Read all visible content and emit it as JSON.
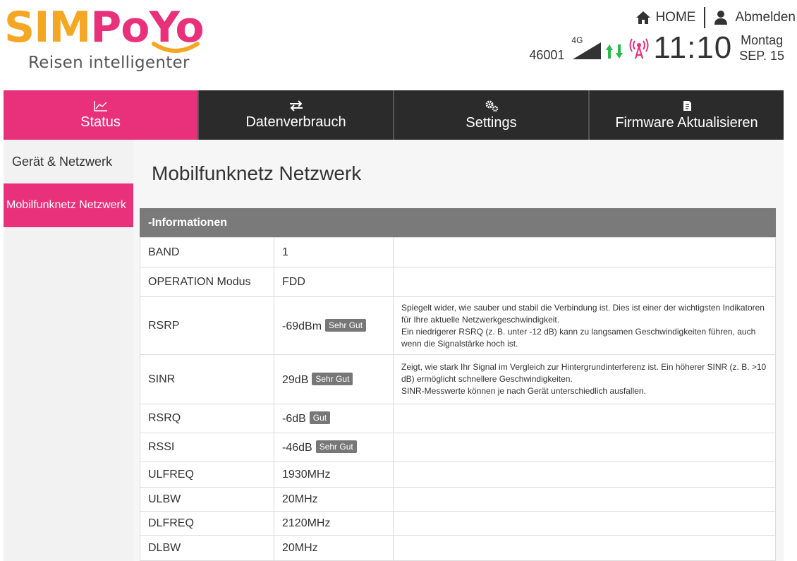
{
  "header": {
    "logo_text_part1": "SIM",
    "logo_text_part2": "PoYo",
    "tagline": "Reisen intelligenter",
    "home_label": "HOME",
    "logout_label": "Abmelden",
    "carrier_code": "46001",
    "network_type": "4G",
    "time": "11:10",
    "weekday": "Montag",
    "date": "SEP. 15",
    "icons": [
      "home-icon",
      "user-icon",
      "signal-strength-icon",
      "data-transfer-icon",
      "antenna-icon"
    ],
    "colors": {
      "brand_orange": "#f5a623",
      "brand_pink": "#e8317a",
      "upload_arrow": "#2db84a",
      "download_arrow": "#2db84a"
    }
  },
  "nav": {
    "tabs": [
      {
        "label": "Status",
        "icon": "chart-line-icon"
      },
      {
        "label": "Datenverbrauch",
        "icon": "transfer-arrows-icon"
      },
      {
        "label": "Settings",
        "icon": "gears-icon"
      },
      {
        "label": "Firmware Aktualisieren",
        "icon": "firmware-icon"
      }
    ],
    "active_tab": "Status"
  },
  "sidebar": {
    "items": [
      {
        "label": "Gerät & Netzwerk"
      },
      {
        "label": "Mobilfunknetz Netzwerk"
      }
    ],
    "active_item": "Mobilfunknetz Netzwerk"
  },
  "main": {
    "title": "Mobilfunknetz Netzwerk",
    "section_header": "-Informationen",
    "rows": [
      {
        "name": "BAND",
        "value": "1",
        "badge": "",
        "desc": [
          "",
          "",
          ""
        ]
      },
      {
        "name": "OPERATION Modus",
        "value": "FDD",
        "badge": "",
        "desc": [
          "",
          "",
          ""
        ]
      },
      {
        "name": "RSRP",
        "value": "-69dBm",
        "badge": "Sehr Gut",
        "desc": [
          "Spiegelt wider, wie sauber und stabil die Verbindung ist. Dies ist einer der wichtigsten Indikatoren für Ihre aktuelle Netzwerkgeschwindigkeit.",
          "Ein niedrigerer RSRQ (z. B. unter -12 dB) kann zu langsamen Geschwindigkeiten führen, auch wenn die Signalstärke hoch ist.",
          ""
        ]
      },
      {
        "name": "SINR",
        "value": "29dB",
        "badge": "Sehr Gut",
        "desc": [
          "Zeigt, wie stark Ihr Signal im Vergleich zur Hintergrundinterferenz ist. Ein höherer SINR (z. B. >10 dB) ermöglicht schnellere Geschwindigkeiten.",
          "SINR-Messwerte können je nach Gerät unterschiedlich ausfallen.",
          ""
        ]
      },
      {
        "name": "RSRQ",
        "value": "-6dB",
        "badge": "Gut",
        "desc": [
          "",
          "",
          ""
        ]
      },
      {
        "name": "RSSI",
        "value": "-46dB",
        "badge": "Sehr Gut",
        "desc": [
          "",
          "",
          ""
        ]
      },
      {
        "name": "ULFREQ",
        "value": "1930MHz",
        "badge": "",
        "desc": [
          "",
          "",
          ""
        ]
      },
      {
        "name": "ULBW",
        "value": "20MHz",
        "badge": "",
        "desc": [
          "",
          "",
          ""
        ]
      },
      {
        "name": "DLFREQ",
        "value": "2120MHz",
        "badge": "",
        "desc": [
          "",
          "",
          ""
        ]
      },
      {
        "name": "DLBW",
        "value": "20MHz",
        "badge": "",
        "desc": [
          "",
          "",
          ""
        ]
      }
    ]
  }
}
